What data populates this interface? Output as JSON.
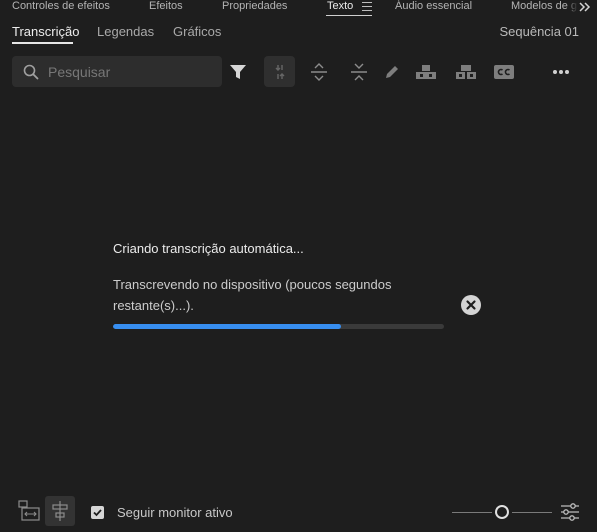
{
  "panel_tabs": [
    {
      "label": "Controles de efeitos"
    },
    {
      "label": "Efeitos"
    },
    {
      "label": "Propriedades"
    },
    {
      "label": "Texto",
      "active": true
    },
    {
      "label": "Áudio essencial"
    },
    {
      "label": "Modelos de g"
    }
  ],
  "sub_tabs": [
    {
      "label": "Transcrição",
      "active": true
    },
    {
      "label": "Legendas"
    },
    {
      "label": "Gráficos"
    }
  ],
  "sequence_name": "Sequência 01",
  "search": {
    "placeholder": "Pesquisar",
    "value": ""
  },
  "toolbar_icons": [
    "filter-icon",
    "split-icon",
    "expand-icon",
    "collapse-icon",
    "pencil-icon",
    "speaker-add-icon",
    "speaker-merge-icon",
    "cc-icon",
    "more-icon"
  ],
  "status": {
    "title": "Criando transcrição automática...",
    "detail": "Transcrevendo no dispositivo (poucos segundos restante(s)...).",
    "progress": 0.69
  },
  "footer": {
    "follow_label": "Seguir monitor ativo",
    "follow_checked": true,
    "zoom_level": 0.5
  },
  "colors": {
    "accent": "#378ef0",
    "background": "#1e1e1e"
  }
}
